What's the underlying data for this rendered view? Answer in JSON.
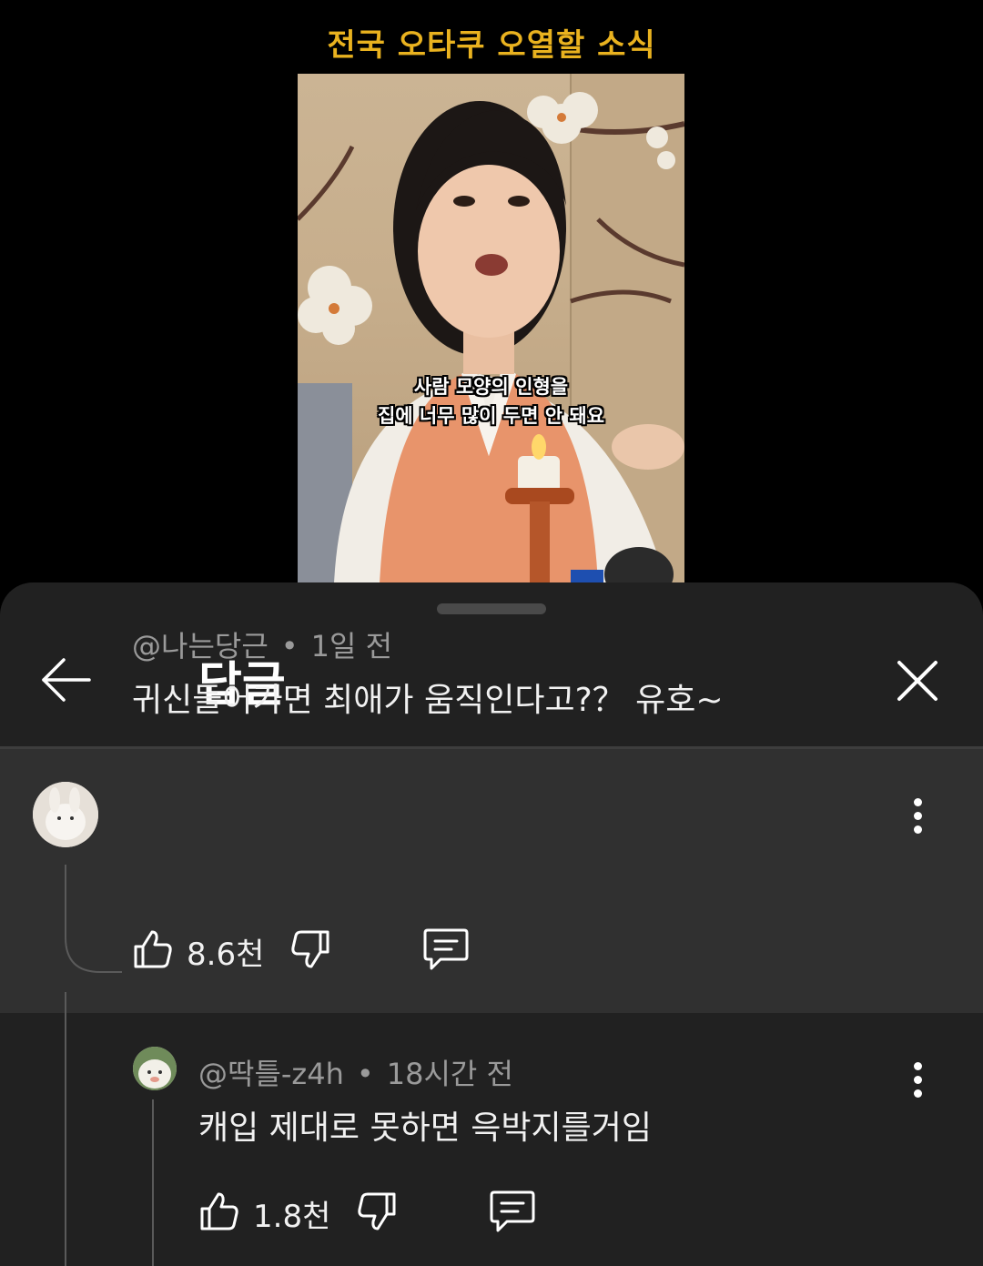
{
  "video": {
    "title": "전국 오타쿠 오열할 소식",
    "subtitle_line1": "사람 모양의 인형을",
    "subtitle_line2": "집에 너무 많이 두면 안 돼요"
  },
  "sheet": {
    "title": "답글"
  },
  "comments": [
    {
      "author": "@나는당근",
      "separator": "•",
      "time": "1일 전",
      "text": "귀신들어가면 최애가 움직인다고?？ 유호~",
      "likes": "8.6천"
    },
    {
      "author": "@딱틀-z4h",
      "separator": "•",
      "time": "18시간 전",
      "text": "캐입 제대로 못하면 윽박지를거임",
      "likes": "1.8천"
    }
  ],
  "colors": {
    "background": "#000000",
    "sheet": "#212121",
    "highlighted_comment": "#303030",
    "title_accent": "#e9b21f",
    "meta_text": "#9a9a9a"
  },
  "icons": {
    "back": "arrow-left-icon",
    "close": "close-icon",
    "more": "more-vertical-icon",
    "like": "thumbs-up-icon",
    "dislike": "thumbs-down-icon",
    "reply": "comment-icon"
  }
}
